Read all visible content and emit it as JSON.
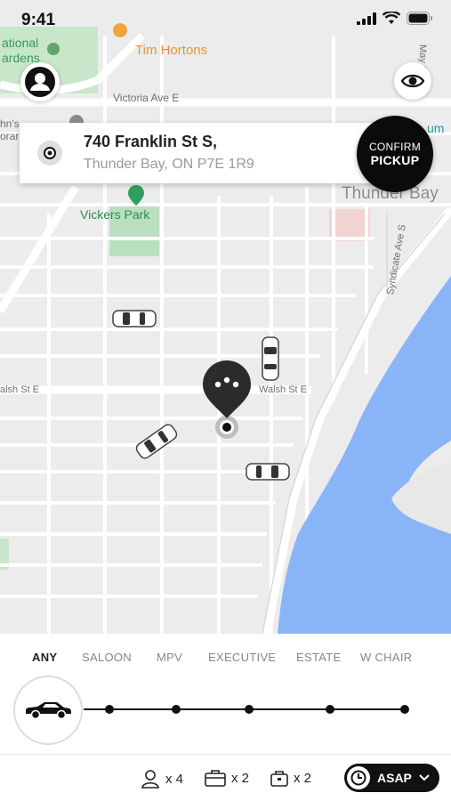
{
  "status_bar": {
    "time": "9:41"
  },
  "map": {
    "labels": {
      "tim_hortons": "Tim Hortons",
      "victoria_ave": "Victoria Ave E",
      "vickers_park": "Vickers Park",
      "thunder_bay": "Thunder Bay",
      "walsh_st_left": "alsh St E",
      "walsh_st_right": "Walsh St E",
      "syndicate_ave": "Syndicate Ave S",
      "may_st": "May St N",
      "national_gardens": "ational\nardens",
      "johns": "hn's\norari",
      "um": "um"
    }
  },
  "address": {
    "line1": "740 Franklin St S,",
    "line2": "Thunder Bay, ON P7E 1R9"
  },
  "confirm": {
    "line1": "CONFIRM",
    "line2": "PICKUP"
  },
  "vehicle_tabs": [
    "ANY",
    "SALOON",
    "MPV",
    "EXECUTIVE",
    "ESTATE",
    "W CHAIR"
  ],
  "selected_tab": "ANY",
  "capacity": {
    "passengers": "x 4",
    "luggage": "x 2",
    "hand_luggage": "x 2"
  },
  "time_select": {
    "label": "ASAP"
  },
  "icons": {
    "profile": "profile-icon",
    "eye": "eye-icon",
    "pin": "location-pin-icon",
    "car": "car-icon",
    "clock": "clock-icon"
  }
}
